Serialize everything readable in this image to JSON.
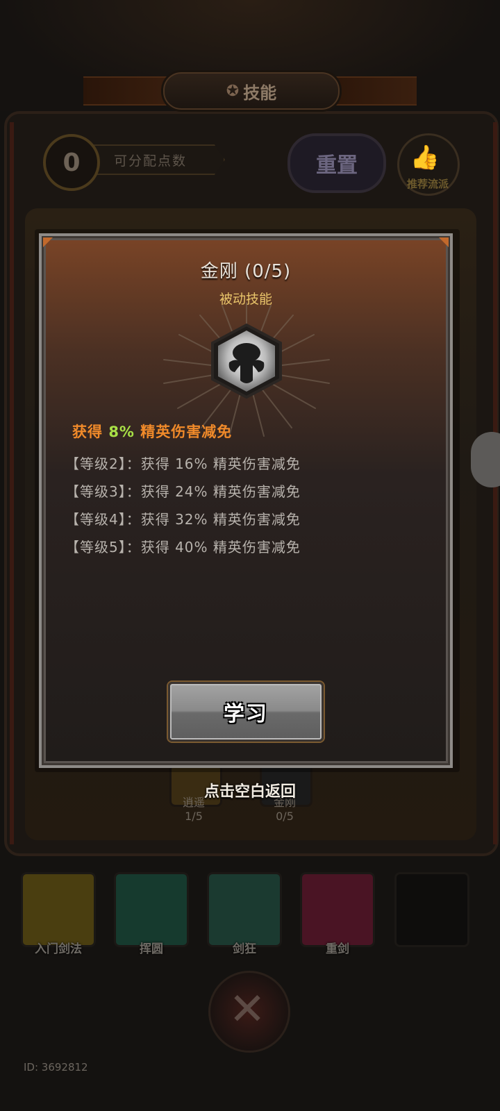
{
  "header": {
    "title": "技能",
    "title_icon": "gear-icon"
  },
  "points": {
    "value": "0",
    "label": "可分配点数"
  },
  "toolbar": {
    "reset_label": "重置",
    "recommend_label": "推荐流派",
    "recommend_icon": "thumbs-up-icon"
  },
  "background_skills": [
    {
      "name": "逍遥",
      "level": "1/5"
    },
    {
      "name": "金刚",
      "level": "0/5"
    }
  ],
  "bottom_skills": [
    {
      "label": "入门剑法",
      "color": "#4a3e10"
    },
    {
      "label": "挥圆",
      "color": "#163a2e"
    },
    {
      "label": "剑狂",
      "color": "#1b3a30"
    },
    {
      "label": "重剑",
      "color": "#4a1424"
    },
    {
      "label": "",
      "color": "#0e0d0c"
    }
  ],
  "footer": {
    "user_id": "ID: 3692812"
  },
  "modal": {
    "title": "金刚 (0/5)",
    "type": "被动技能",
    "icon": "muscle-silhouette-icon",
    "description_prefix": "获得 ",
    "description_value": "8%",
    "description_suffix": " 精英伤害减免",
    "levels": [
      "【等级2】：获得 16% 精英伤害减免",
      "【等级3】：获得 24% 精英伤害减免",
      "【等级4】：获得 32% 精英伤害减免",
      "【等级5】：获得 40% 精英伤害减免"
    ],
    "learn_button": "学习",
    "close_hint": "点击空白返回"
  },
  "colors": {
    "accent_orange": "#f08a2a",
    "highlight_green": "#a8e046",
    "subtitle_gold": "#e9c46a"
  }
}
